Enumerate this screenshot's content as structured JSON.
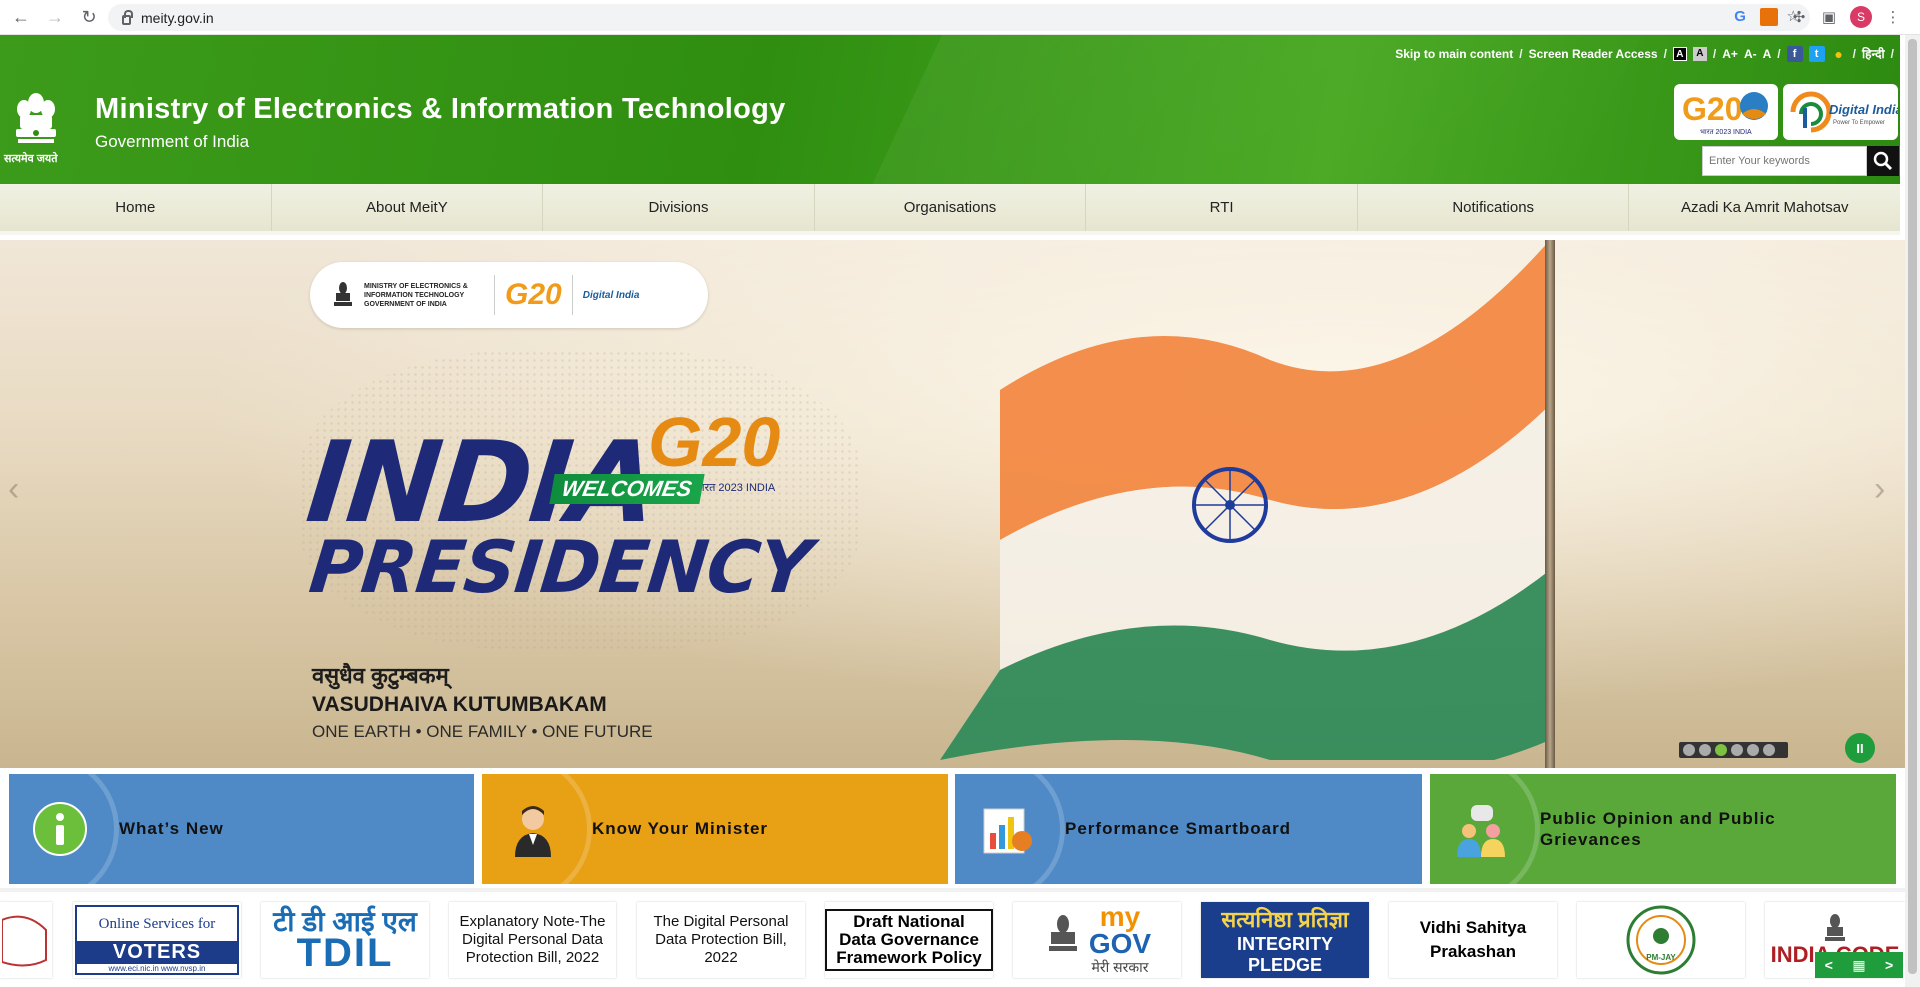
{
  "browser": {
    "url": "meity.gov.in",
    "profile_initial": "S"
  },
  "header": {
    "accessibility_bar": {
      "skip_link": "Skip to main content",
      "screen_reader": "Screen Reader Access",
      "contrast_dark": "A",
      "contrast_light": "A",
      "font_increase": "A+",
      "font_decrease": "A-",
      "font_normal": "A",
      "language": "हिन्दी"
    },
    "emblem_text": "सत्यमेव जयते",
    "title": "Ministry of Electronics & Information Technology",
    "subtitle": "Government of India",
    "search": {
      "placeholder": "Enter Your keywords"
    },
    "g20_logo": {
      "text": "G20",
      "caption": "भारत 2023 INDIA"
    },
    "digital_india_logo": {
      "text": "Digital India",
      "tagline": "Power To Empower"
    }
  },
  "nav": {
    "items": [
      {
        "label": "Home"
      },
      {
        "label": "About MeitY"
      },
      {
        "label": "Divisions"
      },
      {
        "label": "Organisations"
      },
      {
        "label": "RTI"
      },
      {
        "label": "Notifications"
      },
      {
        "label": "Azadi Ka Amrit Mahotsav"
      }
    ]
  },
  "hero": {
    "badge_ministry": "MINISTRY OF ELECTRONICS & INFORMATION TECHNOLOGY GOVERNMENT OF INDIA",
    "badge_g20": "G20",
    "badge_di": "Digital India",
    "headline_1": "INDIA",
    "welcomes": "WELCOMES",
    "g20": "G20",
    "bharat": "भारत 2023 INDIA",
    "headline_2": "PRESIDENCY",
    "hindi_motto": "वसुधैव कुटुम्बकम्",
    "motto": "VASUDHAIVA KUTUMBAKAM",
    "tagline": "ONE EARTH • ONE FAMILY • ONE FUTURE",
    "slides_total": 6,
    "active_slide": 3,
    "prev": "‹",
    "next": "›",
    "pause": "II"
  },
  "tiles": [
    {
      "label": "What’s New",
      "color": "#4f8ac7"
    },
    {
      "label": "Know Your Minister",
      "color": "#e8a014"
    },
    {
      "label": "Performance Smartboard",
      "color": "#4f8ac7"
    },
    {
      "label": "Public Opinion and Public Grievances",
      "color": "#5aa83a"
    }
  ],
  "carousel": {
    "voters": {
      "top": "Online Services for",
      "mid": "VOTERS",
      "bottom": "www.eci.nic.in   www.nvsp.in"
    },
    "tdil": {
      "line1": "टी डी आई एल",
      "line2": "TDIL"
    },
    "explanatory_note": "Explanatory Note-The Digital Personal Data Protection Bill, 2022",
    "dpdp_bill": "The Digital Personal Data Protection Bill, 2022",
    "draft_policy": "Draft National Data Governance Framework Policy",
    "mygov": {
      "my": "my",
      "gov": "GOV",
      "sub": "मेरी सरकार"
    },
    "integrity": {
      "line1": "सत्यनिष्ठा प्रतिज्ञा",
      "line2": "INTEGRITY PLEDGE"
    },
    "vidhi": "Vidhi Sahitya Prakashan",
    "pmjay": "PM-JAY",
    "india_code": "INDIA CODE",
    "ctrl_prev": "<",
    "ctrl_next": ">"
  }
}
